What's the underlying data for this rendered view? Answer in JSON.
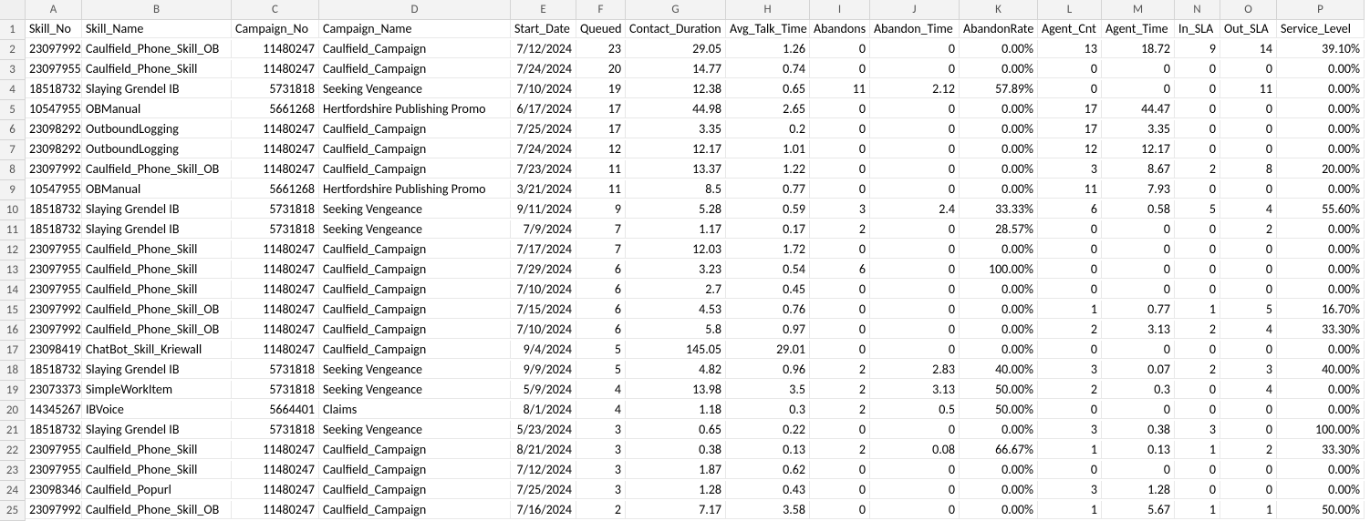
{
  "columns_letters": [
    "A",
    "B",
    "C",
    "D",
    "E",
    "F",
    "G",
    "H",
    "I",
    "J",
    "K",
    "L",
    "M",
    "N",
    "O",
    "P"
  ],
  "headers": [
    "Skill_No",
    "Skill_Name",
    "Campaign_No",
    "Campaign_Name",
    "Start_Date",
    "Queued",
    "Contact_Duration",
    "Avg_Talk_Time",
    "Abandons",
    "Abandon_Time",
    "AbandonRate",
    "Agent_Cnt",
    "Agent_Time",
    "In_SLA",
    "Out_SLA",
    "Service_Level"
  ],
  "row_numbers": [
    "1",
    "2",
    "3",
    "4",
    "5",
    "6",
    "7",
    "8",
    "9",
    "10",
    "11",
    "12",
    "13",
    "14",
    "15",
    "16",
    "17",
    "18",
    "19",
    "20",
    "21",
    "22",
    "23",
    "24",
    "25"
  ],
  "rows": [
    [
      "23097992",
      "Caulfield_Phone_Skill_OB",
      "11480247",
      "Caulfield_Campaign",
      "7/12/2024",
      "23",
      "29.05",
      "1.26",
      "0",
      "0",
      "0.00%",
      "13",
      "18.72",
      "9",
      "14",
      "39.10%"
    ],
    [
      "23097955",
      "Caulfield_Phone_Skill",
      "11480247",
      "Caulfield_Campaign",
      "7/24/2024",
      "20",
      "14.77",
      "0.74",
      "0",
      "0",
      "0.00%",
      "0",
      "0",
      "0",
      "0",
      "0.00%"
    ],
    [
      "18518732",
      "Slaying Grendel IB",
      "5731818",
      "Seeking Vengeance",
      "7/10/2024",
      "19",
      "12.38",
      "0.65",
      "11",
      "2.12",
      "57.89%",
      "0",
      "0",
      "0",
      "11",
      "0.00%"
    ],
    [
      "10547955",
      "OBManual",
      "5661268",
      "Hertfordshire Publishing Promo",
      "6/17/2024",
      "17",
      "44.98",
      "2.65",
      "0",
      "0",
      "0.00%",
      "17",
      "44.47",
      "0",
      "0",
      "0.00%"
    ],
    [
      "23098292",
      "OutboundLogging",
      "11480247",
      "Caulfield_Campaign",
      "7/25/2024",
      "17",
      "3.35",
      "0.2",
      "0",
      "0",
      "0.00%",
      "17",
      "3.35",
      "0",
      "0",
      "0.00%"
    ],
    [
      "23098292",
      "OutboundLogging",
      "11480247",
      "Caulfield_Campaign",
      "7/24/2024",
      "12",
      "12.17",
      "1.01",
      "0",
      "0",
      "0.00%",
      "12",
      "12.17",
      "0",
      "0",
      "0.00%"
    ],
    [
      "23097992",
      "Caulfield_Phone_Skill_OB",
      "11480247",
      "Caulfield_Campaign",
      "7/23/2024",
      "11",
      "13.37",
      "1.22",
      "0",
      "0",
      "0.00%",
      "3",
      "8.67",
      "2",
      "8",
      "20.00%"
    ],
    [
      "10547955",
      "OBManual",
      "5661268",
      "Hertfordshire Publishing Promo",
      "3/21/2024",
      "11",
      "8.5",
      "0.77",
      "0",
      "0",
      "0.00%",
      "11",
      "7.93",
      "0",
      "0",
      "0.00%"
    ],
    [
      "18518732",
      "Slaying Grendel IB",
      "5731818",
      "Seeking Vengeance",
      "9/11/2024",
      "9",
      "5.28",
      "0.59",
      "3",
      "2.4",
      "33.33%",
      "6",
      "0.58",
      "5",
      "4",
      "55.60%"
    ],
    [
      "18518732",
      "Slaying Grendel IB",
      "5731818",
      "Seeking Vengeance",
      "7/9/2024",
      "7",
      "1.17",
      "0.17",
      "2",
      "0",
      "28.57%",
      "0",
      "0",
      "0",
      "2",
      "0.00%"
    ],
    [
      "23097955",
      "Caulfield_Phone_Skill",
      "11480247",
      "Caulfield_Campaign",
      "7/17/2024",
      "7",
      "12.03",
      "1.72",
      "0",
      "0",
      "0.00%",
      "0",
      "0",
      "0",
      "0",
      "0.00%"
    ],
    [
      "23097955",
      "Caulfield_Phone_Skill",
      "11480247",
      "Caulfield_Campaign",
      "7/29/2024",
      "6",
      "3.23",
      "0.54",
      "6",
      "0",
      "100.00%",
      "0",
      "0",
      "0",
      "0",
      "0.00%"
    ],
    [
      "23097955",
      "Caulfield_Phone_Skill",
      "11480247",
      "Caulfield_Campaign",
      "7/10/2024",
      "6",
      "2.7",
      "0.45",
      "0",
      "0",
      "0.00%",
      "0",
      "0",
      "0",
      "0",
      "0.00%"
    ],
    [
      "23097992",
      "Caulfield_Phone_Skill_OB",
      "11480247",
      "Caulfield_Campaign",
      "7/15/2024",
      "6",
      "4.53",
      "0.76",
      "0",
      "0",
      "0.00%",
      "1",
      "0.77",
      "1",
      "5",
      "16.70%"
    ],
    [
      "23097992",
      "Caulfield_Phone_Skill_OB",
      "11480247",
      "Caulfield_Campaign",
      "7/10/2024",
      "6",
      "5.8",
      "0.97",
      "0",
      "0",
      "0.00%",
      "2",
      "3.13",
      "2",
      "4",
      "33.30%"
    ],
    [
      "23098419",
      "ChatBot_Skill_Kriewall",
      "11480247",
      "Caulfield_Campaign",
      "9/4/2024",
      "5",
      "145.05",
      "29.01",
      "0",
      "0",
      "0.00%",
      "0",
      "0",
      "0",
      "0",
      "0.00%"
    ],
    [
      "18518732",
      "Slaying Grendel IB",
      "5731818",
      "Seeking Vengeance",
      "9/9/2024",
      "5",
      "4.82",
      "0.96",
      "2",
      "2.83",
      "40.00%",
      "3",
      "0.07",
      "2",
      "3",
      "40.00%"
    ],
    [
      "23073373",
      "SimpleWorkItem",
      "5731818",
      "Seeking Vengeance",
      "5/9/2024",
      "4",
      "13.98",
      "3.5",
      "2",
      "3.13",
      "50.00%",
      "2",
      "0.3",
      "0",
      "4",
      "0.00%"
    ],
    [
      "14345267",
      "IBVoice",
      "5664401",
      "Claims",
      "8/1/2024",
      "4",
      "1.18",
      "0.3",
      "2",
      "0.5",
      "50.00%",
      "0",
      "0",
      "0",
      "0",
      "0.00%"
    ],
    [
      "18518732",
      "Slaying Grendel IB",
      "5731818",
      "Seeking Vengeance",
      "5/23/2024",
      "3",
      "0.65",
      "0.22",
      "0",
      "0",
      "0.00%",
      "3",
      "0.38",
      "3",
      "0",
      "100.00%"
    ],
    [
      "23097955",
      "Caulfield_Phone_Skill",
      "11480247",
      "Caulfield_Campaign",
      "8/21/2024",
      "3",
      "0.38",
      "0.13",
      "2",
      "0.08",
      "66.67%",
      "1",
      "0.13",
      "1",
      "2",
      "33.30%"
    ],
    [
      "23097955",
      "Caulfield_Phone_Skill",
      "11480247",
      "Caulfield_Campaign",
      "7/12/2024",
      "3",
      "1.87",
      "0.62",
      "0",
      "0",
      "0.00%",
      "0",
      "0",
      "0",
      "0",
      "0.00%"
    ],
    [
      "23098346",
      "Caulfield_Popurl",
      "11480247",
      "Caulfield_Campaign",
      "7/25/2024",
      "3",
      "1.28",
      "0.43",
      "0",
      "0",
      "0.00%",
      "3",
      "1.28",
      "0",
      "0",
      "0.00%"
    ],
    [
      "23097992",
      "Caulfield_Phone_Skill_OB",
      "11480247",
      "Caulfield_Campaign",
      "7/16/2024",
      "2",
      "7.17",
      "3.58",
      "0",
      "0",
      "0.00%",
      "1",
      "5.67",
      "1",
      "1",
      "50.00%"
    ]
  ],
  "col_align": [
    "num",
    "txt",
    "num",
    "txt",
    "num",
    "num",
    "num",
    "num",
    "num",
    "num",
    "num",
    "num",
    "num",
    "num",
    "num",
    "num"
  ]
}
